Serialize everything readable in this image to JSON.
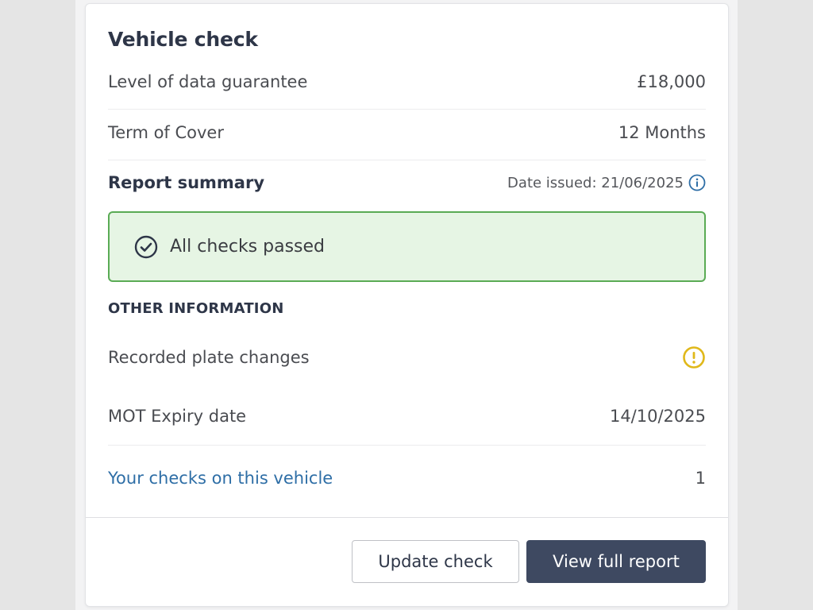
{
  "card": {
    "title": "Vehicle check"
  },
  "details": [
    {
      "label": "Level of data guarantee",
      "value": "£18,000"
    },
    {
      "label": "Term of Cover",
      "value": "12 Months"
    }
  ],
  "report": {
    "heading": "Report summary",
    "date_issued": "Date issued: 21/06/2025",
    "status_text": "All checks passed",
    "status_color": "#5aab55"
  },
  "other_info": {
    "heading": "OTHER INFORMATION",
    "plate_changes_label": "Recorded plate changes",
    "plate_changes_icon": "warning-icon",
    "warning_color": "#e0b81a",
    "mot_label": "MOT Expiry date",
    "mot_value": "14/10/2025",
    "checks_link": "Your checks on this vehicle",
    "checks_count": "1"
  },
  "actions": {
    "update_label": "Update check",
    "view_label": "View full report",
    "primary_color": "#3e4961"
  }
}
